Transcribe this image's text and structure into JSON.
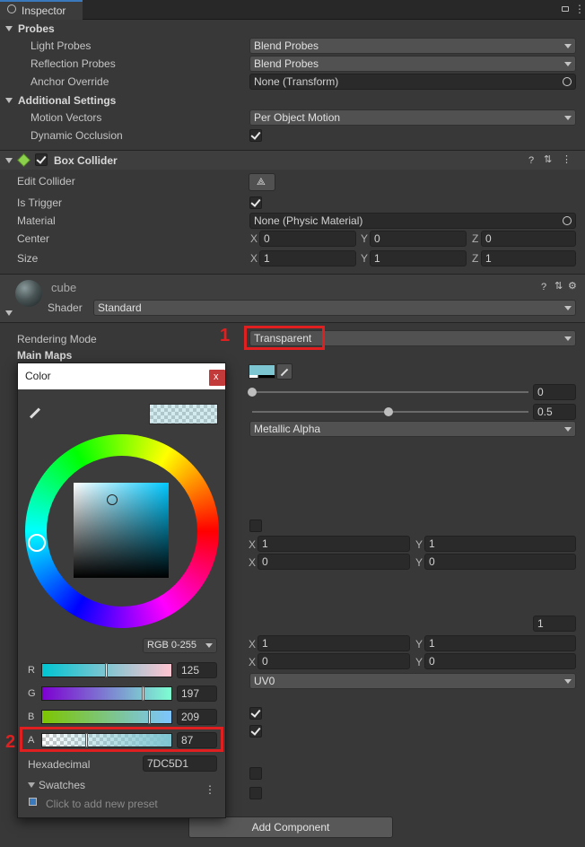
{
  "tab": {
    "title": "Inspector"
  },
  "probes": {
    "header": "Probes",
    "light_probes_label": "Light Probes",
    "light_probes_value": "Blend Probes",
    "reflection_probes_label": "Reflection Probes",
    "reflection_probes_value": "Blend Probes",
    "anchor_override_label": "Anchor Override",
    "anchor_override_value": "None (Transform)"
  },
  "additional": {
    "header": "Additional Settings",
    "motion_vectors_label": "Motion Vectors",
    "motion_vectors_value": "Per Object Motion",
    "dynamic_occlusion_label": "Dynamic Occlusion",
    "dynamic_occlusion_checked": true
  },
  "box_collider": {
    "title": "Box Collider",
    "enabled": true,
    "edit_collider_label": "Edit Collider",
    "is_trigger_label": "Is Trigger",
    "is_trigger_checked": true,
    "material_label": "Material",
    "material_value": "None (Physic Material)",
    "center_label": "Center",
    "center": {
      "x": "0",
      "y": "0",
      "z": "0"
    },
    "size_label": "Size",
    "size": {
      "x": "1",
      "y": "1",
      "z": "1"
    },
    "axis_x": "X",
    "axis_y": "Y",
    "axis_z": "Z"
  },
  "material": {
    "name": "cube",
    "shader_label": "Shader",
    "shader_value": "Standard",
    "rendering_mode_label": "Rendering Mode",
    "rendering_mode_value": "Transparent",
    "main_maps_label": "Main Maps",
    "metallic_value": "0",
    "smoothness_value": "0.5",
    "smoothness_fraction": 0.5,
    "source_value": "Metallic Alpha",
    "tiling": {
      "x": "1",
      "y": "1"
    },
    "offset": {
      "x": "0",
      "y": "0"
    },
    "secondary_value": "1",
    "tiling2": {
      "x": "1",
      "y": "1"
    },
    "offset2": {
      "x": "0",
      "y": "0"
    },
    "uv_set_value": "UV0",
    "albedo_color": "#7DC5D1"
  },
  "annotations": {
    "marker1": "1",
    "marker2": "2",
    "color": "#e02020"
  },
  "color_picker": {
    "title": "Color",
    "close_label": "x",
    "mode_value": "RGB 0-255",
    "r_label": "R",
    "r_value": "125",
    "g_label": "G",
    "g_value": "197",
    "b_label": "B",
    "b_value": "209",
    "a_label": "A",
    "a_value": "87",
    "hex_label": "Hexadecimal",
    "hex_value": "7DC5D1",
    "swatches_label": "Swatches",
    "add_preset_label": "Click to add new preset"
  },
  "add_component_label": "Add Component"
}
